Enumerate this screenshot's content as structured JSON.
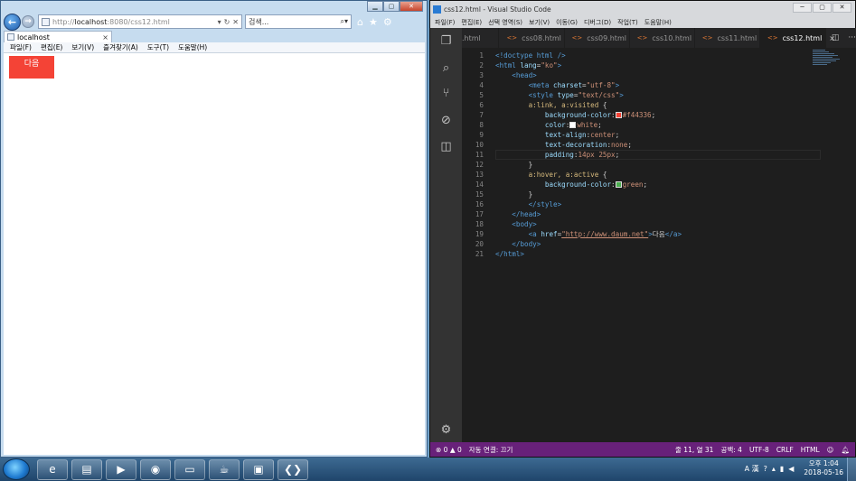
{
  "ie": {
    "address_url_prefix": "http://",
    "address_host": "localhost",
    "address_url_suffix": ":8080/css12.html",
    "search_placeholder": "검색...",
    "tab_title": "localhost",
    "tab_close": "×",
    "menu": [
      "파일(F)",
      "편집(E)",
      "보기(V)",
      "즐겨찾기(A)",
      "도구(T)",
      "도움말(H)"
    ],
    "page_link_text": "다음",
    "link_color": "#f44336"
  },
  "vscode": {
    "title": "css12.html - Visual Studio Code",
    "menu": [
      "파일(F)",
      "편집(E)",
      "선택 영역(S)",
      "보기(V)",
      "이동(G)",
      "디버그(D)",
      "작업(T)",
      "도움말(H)"
    ],
    "tabs": [
      ".html",
      "css08.html",
      "css09.html",
      "css10.html",
      "css11.html",
      "css12.html"
    ],
    "active_tab_close": "×",
    "line_numbers": [
      "1",
      "2",
      "3",
      "4",
      "5",
      "6",
      "7",
      "8",
      "9",
      "10",
      "11",
      "12",
      "13",
      "14",
      "15",
      "16",
      "17",
      "18",
      "19",
      "20",
      "21"
    ],
    "code": {
      "l1": "<!doctype html />",
      "l2_tag": "<html",
      "l2_attr": "lang",
      "l2_str": "\"ko\"",
      "l3": "<head>",
      "l4_tag": "<meta",
      "l4_attr": "charset",
      "l4_str": "\"utf-8\"",
      "l5_tag": "<style",
      "l5_attr": "type",
      "l5_str": "\"text/css\"",
      "l6_sel": "a:link, a:visited",
      "l7_prop": "background-color",
      "l7_val": "#f44336",
      "l8_prop": "color",
      "l8_val": "white",
      "l9_prop": "text-align",
      "l9_val": "center",
      "l10_prop": "text-decoration",
      "l10_val": "none",
      "l11_prop": "padding",
      "l11_val": "14px 25px",
      "l12": "}",
      "l13_sel": "a:hover, a:active",
      "l14_prop": "background-color",
      "l14_val": "green",
      "l15": "}",
      "l16": "</style>",
      "l17": "</head>",
      "l18": "<body>",
      "l19_tag": "<a",
      "l19_attr": "href",
      "l19_str": "\"http://www.daum.net\"",
      "l19_text": "다음",
      "l19_close": "</a>",
      "l20": "</body>",
      "l21": "</html>"
    },
    "status": {
      "errors": "⊗ 0 ▲ 0",
      "autosave": "자동 연결: 끄기",
      "cursor": "줄 11, 열 31",
      "spaces": "공백: 4",
      "encoding": "UTF-8",
      "eol": "CRLF",
      "language": "HTML"
    },
    "swatch_red": "#f44336",
    "swatch_white": "#ffffff",
    "swatch_green": "#4caf50",
    "status_color": "#68217a"
  },
  "taskbar": {
    "clock_time": "오후 1:04",
    "clock_date": "2018-05-16",
    "ime_label": "A 漢"
  },
  "icons": {
    "back": "back-arrow-icon",
    "forward": "forward-arrow-icon",
    "home": "home-icon",
    "favorites": "star-icon",
    "tools": "gear-icon"
  }
}
